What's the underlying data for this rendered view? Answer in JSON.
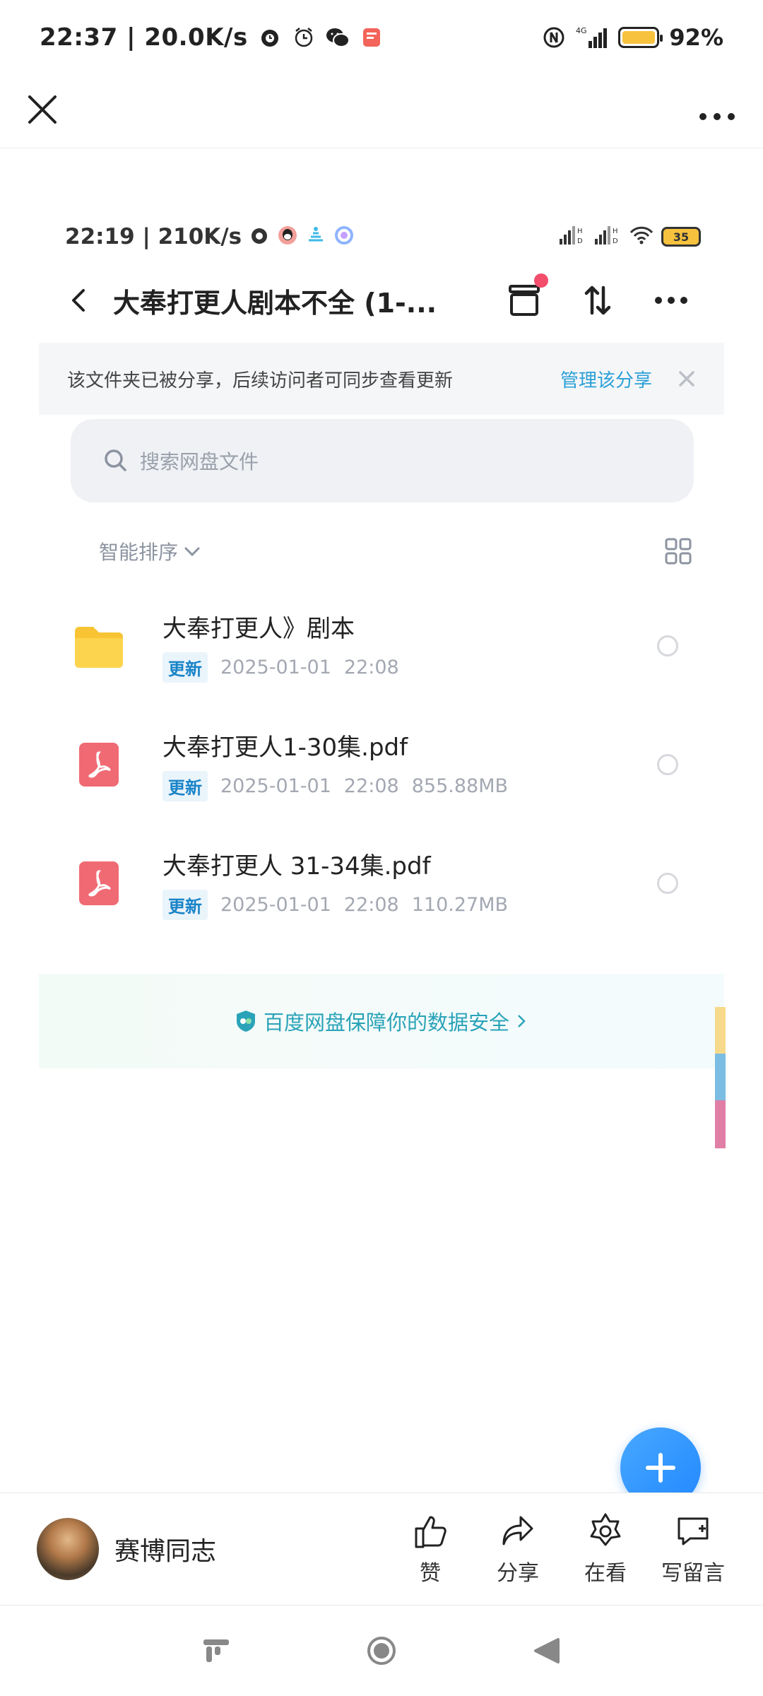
{
  "outer_status": {
    "time": "22:37 | 20.0K/s",
    "battery_pct": "92%",
    "network_label": "4G"
  },
  "inner_status": {
    "time": "22:19 | 210K/s",
    "battery_level": "35"
  },
  "header": {
    "title": "大奉打更人剧本不全 (1-..."
  },
  "banner": {
    "text": "该文件夹已被分享，后续访问者可同步查看更新",
    "link": "管理该分享"
  },
  "search": {
    "placeholder": "搜索网盘文件"
  },
  "sort": {
    "label": "智能排序"
  },
  "files": [
    {
      "name": "大奉打更人》剧本",
      "badge": "更新",
      "date": "2025-01-01",
      "time": "22:08",
      "size": "",
      "type": "folder"
    },
    {
      "name": "大奉打更人1-30集.pdf",
      "badge": "更新",
      "date": "2025-01-01",
      "time": "22:08",
      "size": "855.88MB",
      "type": "pdf"
    },
    {
      "name": "大奉打更人 31-34集.pdf",
      "badge": "更新",
      "date": "2025-01-01",
      "time": "22:08",
      "size": "110.27MB",
      "type": "pdf"
    }
  ],
  "safety": {
    "text": "百度网盘保障你的数据安全"
  },
  "author": {
    "name": "赛博同志"
  },
  "bottom_actions": [
    {
      "label": "赞",
      "icon": "thumbs-up-icon"
    },
    {
      "label": "分享",
      "icon": "share-icon"
    },
    {
      "label": "在看",
      "icon": "star-icon"
    },
    {
      "label": "写留言",
      "icon": "comment-icon"
    }
  ],
  "colors": {
    "accent": "#2aa0d7",
    "fab": "#2288ff",
    "badge_text": "#1a84c8",
    "folder": "#f8c434",
    "pdf": "#f06a74"
  }
}
